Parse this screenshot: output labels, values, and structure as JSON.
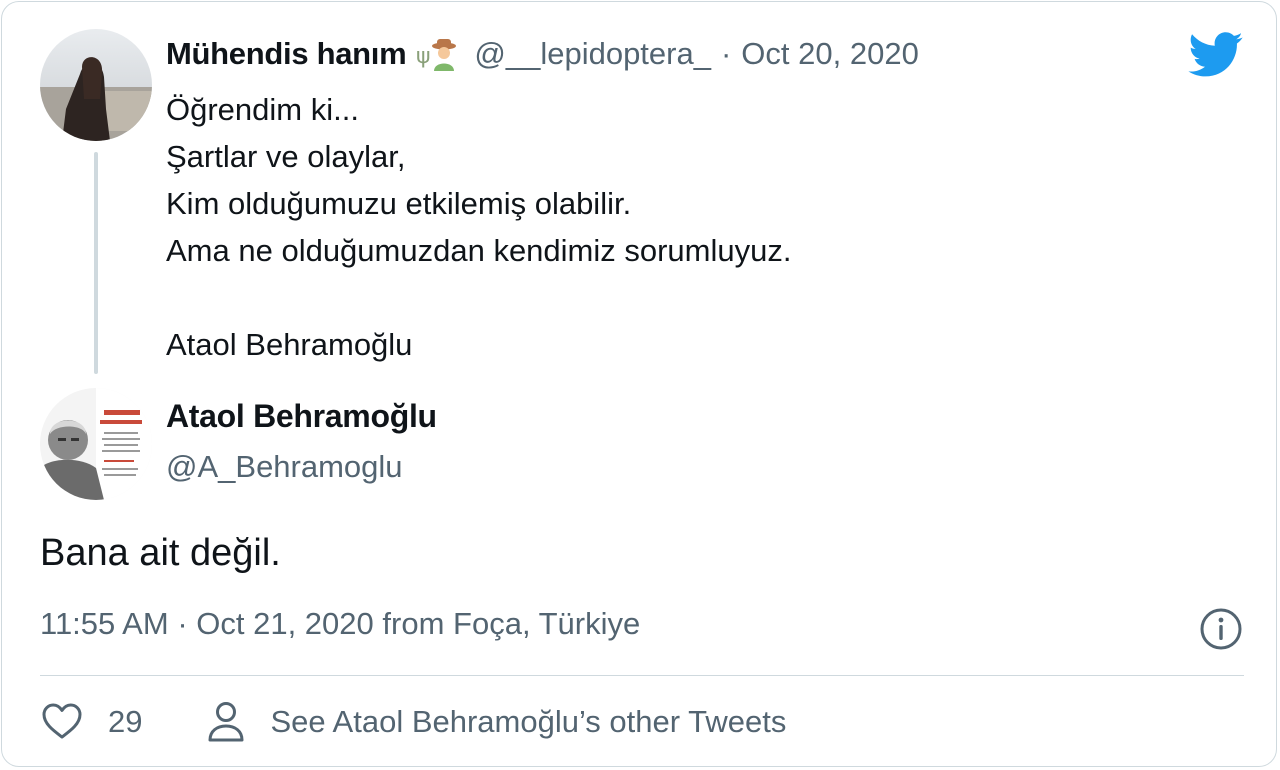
{
  "parent_tweet": {
    "author_name": "Mühendis hanım",
    "emoji_icon": "farmer-emoji-icon",
    "handle": "@__lepidoptera_",
    "separator": "·",
    "date": "Oct 20, 2020",
    "lines": [
      "Öğrendim ki...",
      "Şartlar ve olaylar,",
      "Kim olduğumuzu etkilemiş olabilir.",
      "Ama ne olduğumuzdan kendimiz sorumluyuz.",
      "",
      "Ataol Behramoğlu"
    ]
  },
  "main_tweet": {
    "author_name": "Ataol Behramoğlu",
    "handle": "@A_Behramoglu",
    "text": "Bana ait değil.",
    "time": "11:55 AM",
    "separator": "·",
    "date": "Oct 21, 2020",
    "from_label": "from",
    "location": "Foça, Türkiye"
  },
  "actions": {
    "like_count": "29",
    "see_more_label": "See Ataol Behramoğlu’s other Tweets"
  },
  "icons": {
    "brand": "twitter-bird-icon",
    "info": "info-icon",
    "like": "heart-icon",
    "profile": "person-icon"
  },
  "colors": {
    "brand_blue": "#1d9bf0",
    "text_primary": "#0f1419",
    "text_secondary": "#536471",
    "border": "#cfd9de"
  }
}
